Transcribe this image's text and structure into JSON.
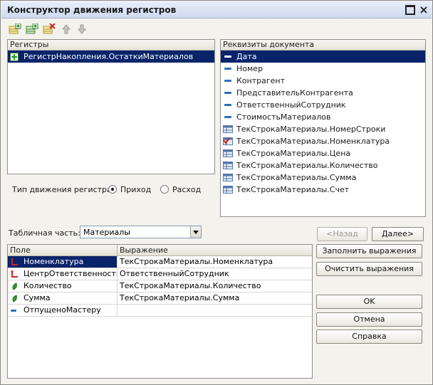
{
  "window": {
    "title": "Конструктор движения регистров"
  },
  "registers_panel": {
    "header": "Регистры",
    "items": [
      {
        "label": "РегистрНакопления.ОстаткиМатериалов",
        "icon": "plus-square-icon"
      }
    ]
  },
  "movement": {
    "label": "Тип движения регистра:",
    "options": [
      {
        "label": "Приход",
        "selected": true
      },
      {
        "label": "Расход",
        "selected": false
      }
    ]
  },
  "attributes_panel": {
    "header": "Реквизиты документа",
    "items": [
      {
        "label": "Дата",
        "icon": "attribute-dash-icon"
      },
      {
        "label": "Номер",
        "icon": "attribute-dash-icon"
      },
      {
        "label": "Контрагент",
        "icon": "attribute-dash-icon"
      },
      {
        "label": "ПредставительКонтрагента",
        "icon": "attribute-dash-icon"
      },
      {
        "label": "ОтветственныйСотрудник",
        "icon": "attribute-dash-icon"
      },
      {
        "label": "СтоимостьМатериалов",
        "icon": "attribute-dash-icon"
      },
      {
        "label": "ТекСтрокаМатериалы.НомерСтроки",
        "icon": "table-icon"
      },
      {
        "label": "ТекСтрокаМатериалы.Номенклатура",
        "icon": "table-checked-icon"
      },
      {
        "label": "ТекСтрокаМатериалы.Цена",
        "icon": "table-icon"
      },
      {
        "label": "ТекСтрокаМатериалы.Количество",
        "icon": "table-icon"
      },
      {
        "label": "ТекСтрокаМатериалы.Сумма",
        "icon": "table-icon"
      },
      {
        "label": "ТекСтрокаМатериалы.Счет",
        "icon": "table-icon"
      }
    ]
  },
  "tabular": {
    "label": "Табличная часть:",
    "value": "Материалы"
  },
  "grid": {
    "headers": [
      "Поле",
      "Выражение"
    ],
    "rows": [
      {
        "field": "Номенклатура",
        "expression": "ТекСтрокаМатериалы.Номенклатура",
        "icon": "dimension-icon"
      },
      {
        "field": "ЦентрОтветственности",
        "expression": "ОтветственныйСотрудник",
        "icon": "dimension-icon"
      },
      {
        "field": "Количество",
        "expression": "ТекСтрокаМатериалы.Количество",
        "icon": "resource-icon"
      },
      {
        "field": "Сумма",
        "expression": "ТекСтрокаМатериалы.Сумма",
        "icon": "resource-icon"
      },
      {
        "field": "ОтпущеноМастеру",
        "expression": "",
        "icon": "attribute-dash-icon"
      }
    ]
  },
  "buttons": {
    "back": "<Назад",
    "next": "Далее>",
    "fill": "Заполнить выражения",
    "clear": "Очистить выражения",
    "ok": "OK",
    "cancel": "Отмена",
    "help": "Справка"
  },
  "colors": {
    "selection": "#0a246a",
    "accent": "#2a6fb8",
    "green": "#1e9a1e"
  }
}
